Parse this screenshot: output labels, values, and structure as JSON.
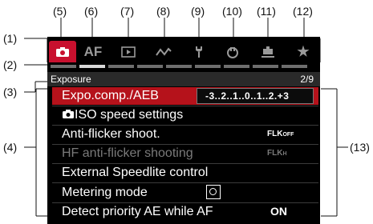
{
  "callouts": {
    "c1": "(1)",
    "c2": "(2)",
    "c3": "(3)",
    "c4": "(4)",
    "c5": "(5)",
    "c6": "(6)",
    "c7": "(7)",
    "c8": "(8)",
    "c9": "(9)",
    "c10": "(10)",
    "c11": "(11)",
    "c12": "(12)",
    "c13": "(13)"
  },
  "tabs": [
    {
      "name": "shooting",
      "icon": "camera-icon",
      "active": true
    },
    {
      "name": "af",
      "label": "AF"
    },
    {
      "name": "playback",
      "icon": "playback-icon"
    },
    {
      "name": "wireless",
      "icon": "wireless-icon"
    },
    {
      "name": "setup",
      "icon": "wrench-icon"
    },
    {
      "name": "custom-functions",
      "icon": "custom-functions-icon"
    },
    {
      "name": "my-menu",
      "icon": "my-menu-icon"
    },
    {
      "name": "favorites",
      "icon": "star-icon",
      "label": "★"
    }
  ],
  "section": {
    "title": "Exposure",
    "page": "2/9"
  },
  "menu_items": [
    {
      "label": "Expo.comp./AEB",
      "selected": true,
      "value": "-3..2..1..0..1..2.+3"
    },
    {
      "label": "ISO speed settings",
      "icon": "camera-icon"
    },
    {
      "label": "Anti-flicker shoot.",
      "value_icon": "flicker-off-icon"
    },
    {
      "label": "HF anti-flicker shooting",
      "disabled": true,
      "value_icon": "hf-flicker-off-icon"
    },
    {
      "label": "External Speedlite control"
    },
    {
      "label": "Metering mode",
      "value_icon": "evaluative-metering-icon"
    },
    {
      "label": "Detect priority AE while AF",
      "value": "ON"
    }
  ],
  "flicker": {
    "main": "FLK",
    "sub": "OFF",
    "hf_sub": "H"
  },
  "colors": {
    "active_tab": "#c8102e",
    "selected_item": "#b5121b",
    "screen_bg": "#000000"
  }
}
